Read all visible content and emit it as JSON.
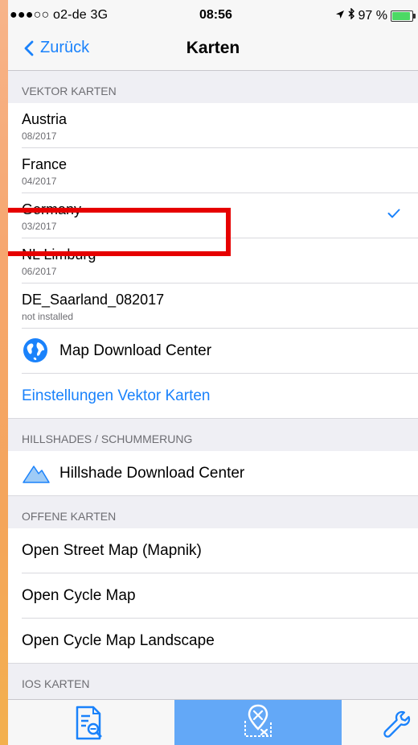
{
  "status": {
    "carrier": "●●●○○ o2-de  3G",
    "time": "08:56",
    "battery_text": "97 %",
    "battery_level": 0.97
  },
  "nav": {
    "back_label": "Zurück",
    "title": "Karten"
  },
  "sections": {
    "vector": {
      "header": "VEKTOR KARTEN",
      "maps": [
        {
          "name": "Austria",
          "date": "08/2017"
        },
        {
          "name": "France",
          "date": "04/2017"
        },
        {
          "name": "Germany",
          "date": "03/2017",
          "selected": true
        },
        {
          "name": "NL Limburg",
          "date": "06/2017"
        },
        {
          "name": "DE_Saarland_082017",
          "date": "not installed"
        }
      ],
      "download_center": "Map Download Center",
      "settings_link": "Einstellungen Vektor Karten"
    },
    "hillshades": {
      "header": "HILLSHADES / SCHUMMERUNG",
      "download_center": "Hillshade Download Center"
    },
    "open": {
      "header": "OFFENE KARTEN",
      "items": [
        "Open Street Map (Mapnik)",
        "Open Cycle Map",
        "Open Cycle Map Landscape"
      ]
    },
    "ios": {
      "header": "IOS KARTEN"
    }
  },
  "colors": {
    "accent": "#1a82fb",
    "tab_active": "#63a8f7",
    "highlight": "#e60000"
  },
  "tabs": [
    {
      "icon": "document-search-icon",
      "active": false
    },
    {
      "icon": "map-pin-icon",
      "active": true
    },
    {
      "icon": "wrench-icon",
      "active": false
    }
  ]
}
